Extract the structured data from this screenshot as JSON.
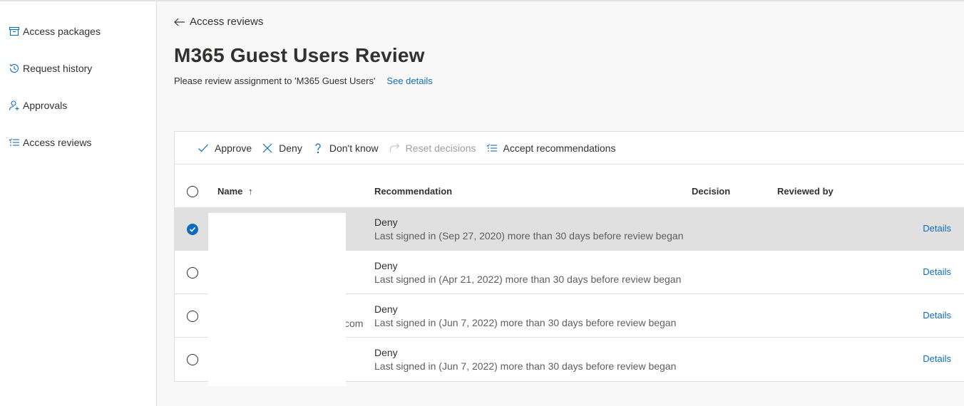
{
  "sidebar": {
    "items": [
      {
        "label": "Access packages",
        "icon": "package-icon"
      },
      {
        "label": "Request history",
        "icon": "history-icon"
      },
      {
        "label": "Approvals",
        "icon": "person-add-icon"
      },
      {
        "label": "Access reviews",
        "icon": "checklist-icon"
      }
    ]
  },
  "header": {
    "back_label": "Access reviews",
    "title": "M365 Guest Users Review",
    "subtitle": "Please review assignment to 'M365 Guest Users'",
    "see_details": "See details"
  },
  "toolbar": {
    "approve": "Approve",
    "deny": "Deny",
    "dont_know": "Don't know",
    "reset": "Reset decisions",
    "accept": "Accept recommendations"
  },
  "table": {
    "columns": {
      "name": "Name",
      "sort_indicator": "↑",
      "recommendation": "Recommendation",
      "decision": "Decision",
      "reviewed_by": "Reviewed by"
    },
    "rows": [
      {
        "name_visible": "",
        "recommendation": "Deny",
        "reason": "Last signed in (Sep 27, 2020) more than 30 days before review began",
        "details": "Details",
        "selected": true
      },
      {
        "name_visible": "",
        "recommendation": "Deny",
        "reason": "Last signed in (Apr 21, 2022) more than 30 days before review began",
        "details": "Details",
        "selected": false
      },
      {
        "name_visible": "com",
        "recommendation": "Deny",
        "reason": "Last signed in (Jun 7, 2022) more than 30 days before review began",
        "details": "Details",
        "selected": false
      },
      {
        "name_visible": "",
        "recommendation": "Deny",
        "reason": "Last signed in (Jun 7, 2022) more than 30 days before review began",
        "details": "Details",
        "selected": false
      }
    ]
  },
  "colors": {
    "accent": "#0f6cbd",
    "selected_row": "#e0e0e0"
  }
}
